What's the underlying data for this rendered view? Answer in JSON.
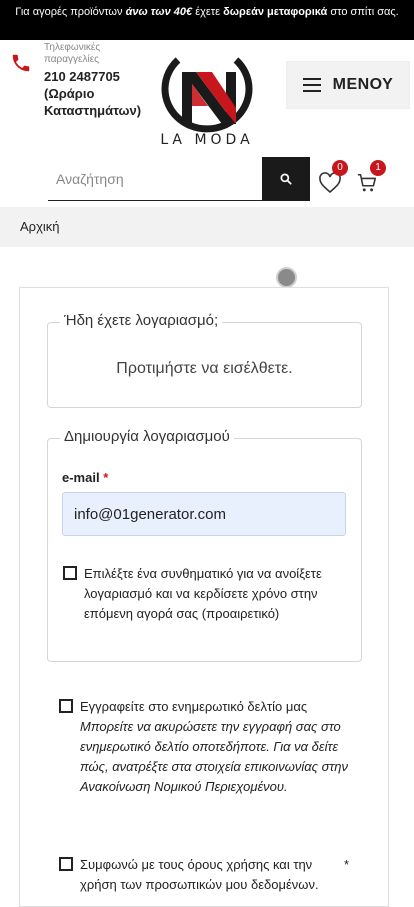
{
  "announcement": {
    "part1": "Για αγορές προϊόντων",
    "part2": "άνω των 40€",
    "part3": "έχετε",
    "part4": "δωρεάν μεταφορικά",
    "part5": "στο σπίτι σας."
  },
  "header": {
    "phone_caption": "Τηλεφωνικές παραγγελίες",
    "phone_number": "210 2487705",
    "phone_hours": "(Ωράριο Καταστημάτων)",
    "logo_text": "LA MODA",
    "menu_label": "ΜΕΝΟΥ"
  },
  "search": {
    "placeholder": "Αναζήτηση",
    "value": ""
  },
  "wishlist": {
    "count": "0"
  },
  "cart": {
    "count": "1"
  },
  "breadcrumb": {
    "home": "Αρχική"
  },
  "login_section": {
    "legend": "Ήδη έχετε λογαριασμό;",
    "prompt": "Προτιμήστε να εισέλθετε."
  },
  "register_section": {
    "legend": "Δημιουργία λογαριασμού",
    "email_label": "e-mail",
    "required_mark": "*",
    "email_value": "info@01generator.com",
    "password_option": "Επιλέξτε ένα συνθηματικό για να ανοίξετε λογαριασμό και να κερδίσετε χρόνο στην επόμενη αγορά σας (προαιρετικό)"
  },
  "newsletter": {
    "label": "Εγγραφείτε στο ενημερωτικό δελτίο μας",
    "note": "Μπορείτε να ακυρώσετε την εγγραφή σας στο ενημερωτικό δελτίο οποτεδήποτε. Για να δείτε πώς, ανατρέξτε στα στοιχεία επικοινωνίας στην Ανακοίνωση Νομικού Περιεχομένου."
  },
  "terms": {
    "label": "Συμφωνώ με τους όρους χρήσης και την χρήση των προσωπικών μου δεδομένων.",
    "required_mark": "*"
  },
  "colors": {
    "accent": "#c8161d",
    "dark": "#1a1a1a",
    "autofill": "#e8f0fe"
  }
}
